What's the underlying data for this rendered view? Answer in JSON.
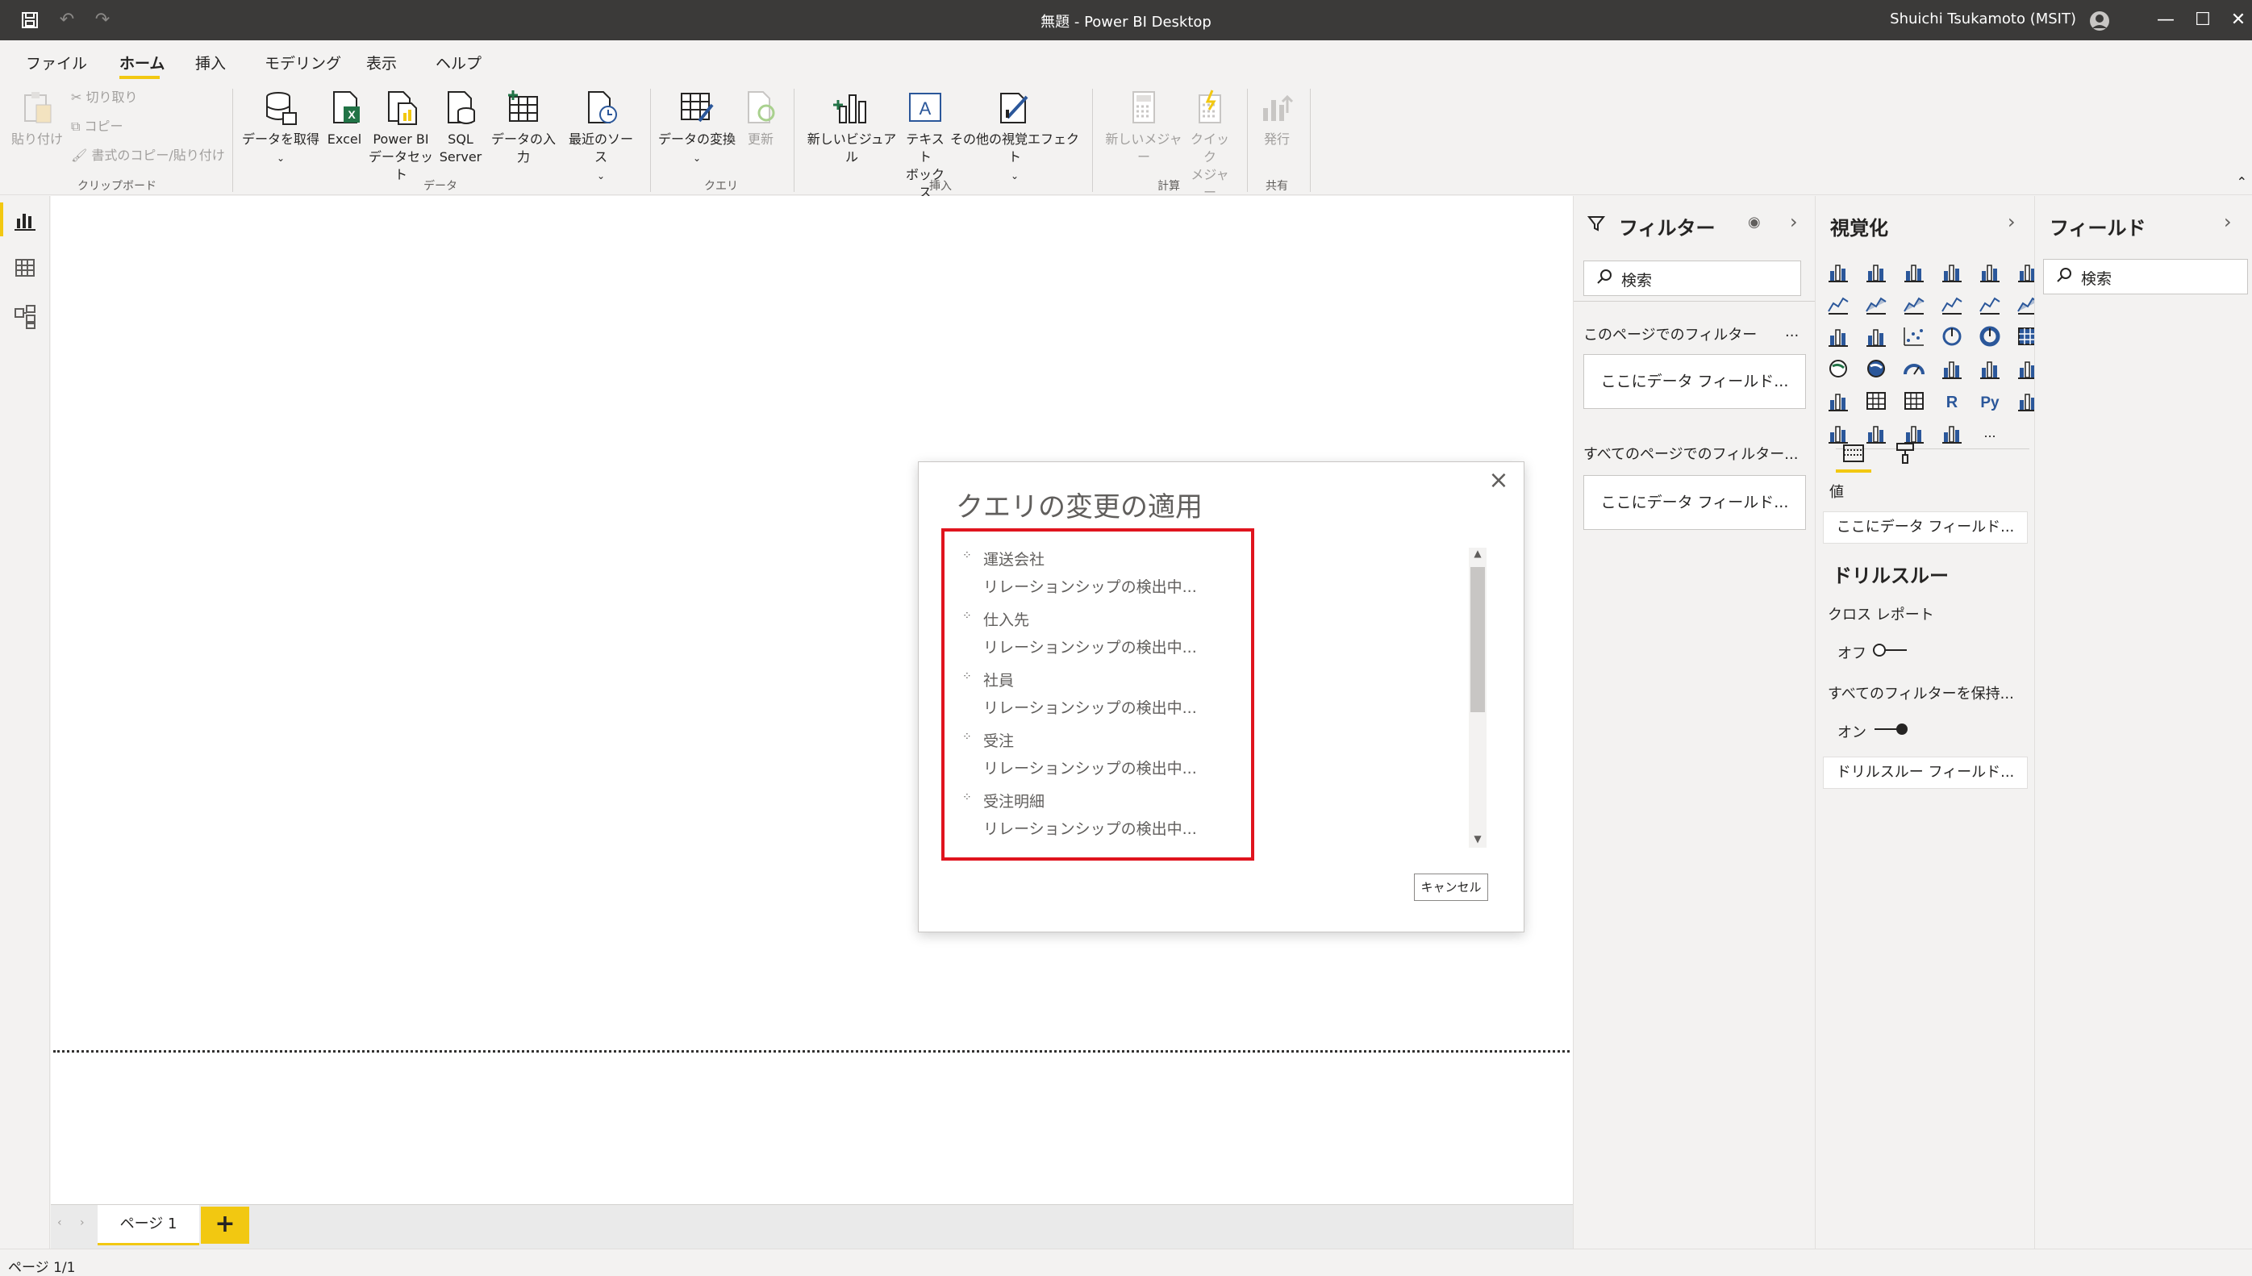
{
  "window": {
    "title": "無題 - Power BI Desktop",
    "user": "Shuichi Tsukamoto (MSIT)"
  },
  "menu": [
    "ファイル",
    "ホーム",
    "挿入",
    "モデリング",
    "表示",
    "ヘルプ"
  ],
  "ribbon": {
    "clipboard": {
      "paste": "貼り付け",
      "cut": "切り取り",
      "copy": "コピー",
      "format_painter": "書式のコピー/貼り付け",
      "group": "クリップボード"
    },
    "data": {
      "get_data": "データを取得",
      "excel": "Excel",
      "pbi_1": "Power BI",
      "pbi_2": "データセット",
      "sql_1": "SQL",
      "sql_2": "Server",
      "enter_data": "データの入力",
      "recent": "最近のソース",
      "group": "データ"
    },
    "query": {
      "transform": "データの変換",
      "refresh": "更新",
      "group": "クエリ"
    },
    "insert": {
      "new_visual": "新しいビジュアル",
      "textbox_1": "テキスト",
      "textbox_2": "ボックス",
      "more_visuals": "その他の視覚エフェクト",
      "group": "挿入"
    },
    "calc": {
      "new_measure": "新しいメジャー",
      "quick_1": "クイック",
      "quick_2": "メジャー",
      "group": "計算"
    },
    "share": {
      "publish": "発行",
      "group": "共有"
    }
  },
  "filters": {
    "title": "フィルター",
    "search": "検索",
    "this_page": "このページでのフィルター",
    "more": "...",
    "this_page_well": "ここにデータ フィールド...",
    "all_pages": "すべてのページでのフィルター...",
    "all_pages_well": "ここにデータ フィールド..."
  },
  "viz": {
    "title": "視覚化",
    "r_label": "R",
    "py_label": "Py",
    "more": "...",
    "values_label": "値",
    "values_well": "ここにデータ フィールド...",
    "drill_title": "ドリルスルー",
    "cross_report": "クロス レポート",
    "off": "オフ",
    "keep_filters": "すべてのフィルターを保持...",
    "on": "オン",
    "drill_well": "ドリルスルー フィールド..."
  },
  "fields": {
    "title": "フィールド",
    "search": "検索"
  },
  "pages": {
    "tab": "ページ 1",
    "add": "+"
  },
  "status": "ページ 1/1",
  "dialog": {
    "title": "クエリの変更の適用",
    "items": [
      {
        "name": "運送会社",
        "status": "リレーションシップの検出中..."
      },
      {
        "name": "仕入先",
        "status": "リレーションシップの検出中..."
      },
      {
        "name": "社員",
        "status": "リレーションシップの検出中..."
      },
      {
        "name": "受注",
        "status": "リレーションシップの検出中..."
      },
      {
        "name": "受注明細",
        "status": "リレーションシップの検出中..."
      }
    ],
    "cancel": "キャンセル"
  },
  "colors": {
    "accent": "#f2c811",
    "highlight": "#e0141e",
    "titlebar": "#3b3a39",
    "viz_blue": "#2b579a"
  }
}
